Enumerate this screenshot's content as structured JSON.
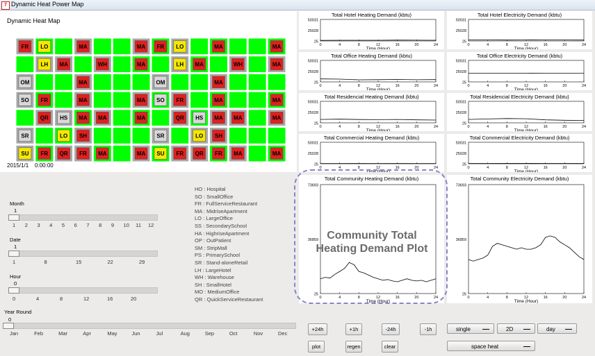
{
  "window": {
    "title": "Dynamic Heat Power Map"
  },
  "map": {
    "title": "Dynamic Heat Map",
    "date": "2015/1/1",
    "time": "0:00:00",
    "rows": [
      [
        "FR",
        "LO",
        "",
        "MA",
        "",
        "",
        "MA",
        "FR",
        "LO",
        "",
        "MA",
        "",
        "",
        "MA"
      ],
      [
        "",
        "LH",
        "MA",
        "",
        "WH",
        "",
        "MA",
        "",
        "LH",
        "MA",
        "",
        "WH",
        "",
        "MA"
      ],
      [
        "OM",
        "",
        "",
        "MA",
        "",
        "",
        "",
        "OM",
        "",
        "",
        "MA",
        "",
        "",
        ""
      ],
      [
        "SO",
        "FR",
        "",
        "MA",
        "",
        "",
        "MA",
        "SO",
        "FR",
        "",
        "MA",
        "",
        "",
        "MA"
      ],
      [
        "",
        "QR",
        "HS",
        "MA",
        "MA",
        "",
        "MA",
        "",
        "QR",
        "HS",
        "MA",
        "MA",
        "",
        "MA"
      ],
      [
        "SR",
        "",
        "LO",
        "SH",
        "",
        "",
        "",
        "SR",
        "",
        "LO",
        "SH",
        "",
        "",
        ""
      ],
      [
        "SU",
        "FR",
        "QR",
        "FR",
        "MA",
        "",
        "MA",
        "SU",
        "FR",
        "QR",
        "FR",
        "MA",
        "",
        "MA"
      ]
    ]
  },
  "charts": [
    {
      "id": "hotel-heating",
      "title": "Total Hotel Heating Demand (kbtu)",
      "yticks": [
        "50031",
        "25028",
        "25"
      ],
      "xticks": [
        "0",
        "4",
        "8",
        "12",
        "16",
        "20",
        "24"
      ],
      "xlabel": "Time (Hour)"
    },
    {
      "id": "hotel-electricity",
      "title": "Total Hotel Electricity Demand (kbtu)",
      "yticks": [
        "50031",
        "25028",
        "25"
      ],
      "xticks": [
        "0",
        "4",
        "8",
        "12",
        "16",
        "20",
        "24"
      ],
      "xlabel": "Time (Hour)"
    },
    {
      "id": "office-heating",
      "title": "Total Office Heating Demand (kbtu)",
      "yticks": [
        "50031",
        "25028",
        "25"
      ],
      "xticks": [
        "0",
        "4",
        "8",
        "12",
        "16",
        "20",
        "24"
      ],
      "xlabel": "Time (Hour)"
    },
    {
      "id": "office-electricity",
      "title": "Total Office Electricity Demand (kbtu)",
      "yticks": [
        "50031",
        "25028",
        "25"
      ],
      "xticks": [
        "0",
        "4",
        "8",
        "12",
        "16",
        "20",
        "24"
      ],
      "xlabel": "Time (Hour)"
    },
    {
      "id": "residential-heating",
      "title": "Total Residencial Heating Demand (kbtu)",
      "yticks": [
        "50031",
        "25028",
        "25"
      ],
      "xticks": [
        "0",
        "4",
        "8",
        "12",
        "16",
        "20",
        "24"
      ],
      "xlabel": "Time (Hour)"
    },
    {
      "id": "residential-electricity",
      "title": "Total Residencial Electricity Demand (kbtu)",
      "yticks": [
        "50031",
        "25028",
        "25"
      ],
      "xticks": [
        "0",
        "4",
        "8",
        "12",
        "16",
        "20",
        "24"
      ],
      "xlabel": "Time (Hour)"
    },
    {
      "id": "commercial-heating",
      "title": "Total Commercial Heating Demand (kbtu)",
      "yticks": [
        "50031",
        "25028",
        "25"
      ],
      "xticks": [
        "0",
        "4",
        "8",
        "12",
        "16",
        "20",
        "24"
      ],
      "xlabel": "Time (Hour)"
    },
    {
      "id": "commercial-electricity",
      "title": "Total Commercial Electricity Demand (kbtu)",
      "yticks": [
        "50031",
        "25028",
        "25"
      ],
      "xticks": [
        "0",
        "4",
        "8",
        "12",
        "16",
        "20",
        "24"
      ],
      "xlabel": "Time (Hour)"
    },
    {
      "id": "community-heating",
      "title": "Total Community Heating Demand (kbtu)",
      "yticks": [
        "73693",
        "36859",
        "25"
      ],
      "xticks": [
        "0",
        "4",
        "8",
        "12",
        "16",
        "20",
        "24"
      ],
      "xlabel": "Time (Hour)"
    },
    {
      "id": "community-electricity",
      "title": "Total Community Electricity Demand (kbtu)",
      "yticks": [
        "73693",
        "36859",
        "25"
      ],
      "xticks": [
        "0",
        "4",
        "8",
        "12",
        "16",
        "20",
        "24"
      ],
      "xlabel": "Time (Hour)"
    }
  ],
  "chart_data": [
    {
      "type": "line",
      "title": "Total Hotel Heating Demand (kbtu)",
      "xlabel": "Time (Hour)",
      "ylim": [
        25,
        50031
      ],
      "x": [
        0,
        4,
        8,
        12,
        16,
        20,
        24
      ],
      "values": [
        1500,
        1600,
        1700,
        1600,
        2000,
        1800,
        1600
      ]
    },
    {
      "type": "line",
      "title": "Total Hotel Electricity Demand (kbtu)",
      "xlabel": "Time (Hour)",
      "ylim": [
        25,
        50031
      ],
      "x": [
        0,
        4,
        8,
        12,
        16,
        20,
        24
      ],
      "values": [
        2600,
        2400,
        2200,
        2300,
        2500,
        2300,
        2200
      ]
    },
    {
      "type": "line",
      "title": "Total Office Heating Demand (kbtu)",
      "xlabel": "Time (Hour)",
      "ylim": [
        25,
        50031
      ],
      "x": [
        0,
        4,
        8,
        12,
        16,
        20,
        24
      ],
      "values": [
        7000,
        6500,
        4800,
        5200,
        5600,
        5000,
        5400
      ]
    },
    {
      "type": "line",
      "title": "Total Office Electricity Demand (kbtu)",
      "xlabel": "Time (Hour)",
      "ylim": [
        25,
        50031
      ],
      "x": [
        0,
        4,
        8,
        12,
        16,
        20,
        24
      ],
      "values": [
        20000,
        20000,
        20200,
        20300,
        20100,
        20000,
        20000
      ]
    },
    {
      "type": "line",
      "title": "Total Residencial Heating Demand (kbtu)",
      "xlabel": "Time (Hour)",
      "ylim": [
        25,
        50031
      ],
      "x": [
        0,
        4,
        8,
        12,
        16,
        20,
        24
      ],
      "values": [
        8000,
        8600,
        7800,
        7400,
        8000,
        7000,
        6500
      ]
    },
    {
      "type": "line",
      "title": "Total Residencial Electricity Demand (kbtu)",
      "xlabel": "Time (Hour)",
      "ylim": [
        25,
        50031
      ],
      "x": [
        0,
        4,
        8,
        12,
        16,
        20,
        24
      ],
      "values": [
        8000,
        9000,
        10000,
        9500,
        7000,
        6000,
        5500
      ]
    },
    {
      "type": "line",
      "title": "Total Commercial Heating Demand (kbtu)",
      "xlabel": "Time (Hour)",
      "ylim": [
        25,
        50031
      ],
      "x": [
        0,
        4,
        8,
        12,
        16,
        20,
        24
      ],
      "values": [
        600,
        700,
        800,
        700,
        800,
        700,
        700
      ]
    },
    {
      "type": "line",
      "title": "Total Commercial Electricity Demand (kbtu)",
      "xlabel": "Time (Hour)",
      "ylim": [
        25,
        50031
      ],
      "x": [
        0,
        4,
        8,
        12,
        16,
        20,
        24
      ],
      "values": [
        900,
        900,
        950,
        950,
        900,
        900,
        900
      ]
    },
    {
      "type": "line",
      "title": "Total Community Heating Demand (kbtu)",
      "xlabel": "Time (Hour)",
      "ylim": [
        25,
        73693
      ],
      "x": [
        0,
        1,
        2,
        3,
        4,
        5,
        6,
        7,
        8,
        9,
        10,
        11,
        12,
        13,
        14,
        15,
        16,
        17,
        18,
        19,
        20,
        21,
        22,
        23,
        24
      ],
      "values": [
        10000,
        11000,
        10500,
        13000,
        15000,
        17000,
        21000,
        19500,
        15000,
        14000,
        12500,
        11000,
        10000,
        9000,
        9500,
        8500,
        8000,
        9000,
        10000,
        9000,
        8500,
        9000,
        8000,
        9000,
        10000
      ]
    },
    {
      "type": "line",
      "title": "Total Community Electricity Demand (kbtu)",
      "xlabel": "Time (Hour)",
      "ylim": [
        25,
        73693
      ],
      "x": [
        0,
        1,
        2,
        3,
        4,
        5,
        6,
        7,
        8,
        9,
        10,
        11,
        12,
        13,
        14,
        15,
        16,
        17,
        18,
        19,
        20,
        21,
        22,
        23,
        24
      ],
      "values": [
        23000,
        22000,
        23000,
        24000,
        26000,
        32000,
        34000,
        33000,
        32000,
        31000,
        30000,
        31000,
        30000,
        30000,
        31000,
        33000,
        38000,
        39000,
        38000,
        35000,
        33000,
        31000,
        28000,
        25000,
        23000
      ]
    }
  ],
  "overlay": {
    "line1": "Community Total",
    "line2": "Heating Demand Plot"
  },
  "legend": [
    "HO : Hospital",
    "SO : SmallOffice",
    "FR : FullServiceRestaurant",
    "MA : MidriseApartment",
    "LO : LargeOffice",
    "SS : SecondarySchool",
    "HA : HighriseApartment",
    "OP : OutPatient",
    "SM : StripMall",
    "PS : PrimarySchool",
    "SR : Stand-aloneRetail",
    "LH : LargeHotel",
    "WH : Warehouse",
    "SH : SmallHotel",
    "MO : MediumOffice",
    "QR : QuickServiceRestaurant"
  ],
  "sliders": {
    "month": {
      "label": "Month",
      "value": "1",
      "ticks": [
        "1",
        "2",
        "3",
        "4",
        "5",
        "6",
        "7",
        "8",
        "9",
        "10",
        "11",
        "12"
      ]
    },
    "date": {
      "label": "Date",
      "value": "1",
      "ticks": [
        "1",
        "8",
        "15",
        "22",
        "29"
      ]
    },
    "hour": {
      "label": "Hour",
      "value": "0",
      "ticks": [
        "0",
        "4",
        "8",
        "12",
        "16",
        "20"
      ]
    },
    "year": {
      "label": "Year Round",
      "value": "0",
      "ticks": [
        "Jan",
        "Feb",
        "Mar",
        "Apr",
        "May",
        "Jun",
        "Jul",
        "Aug",
        "Sep",
        "Oct",
        "Nov",
        "Dec"
      ]
    }
  },
  "buttons": {
    "plus24": "+24h",
    "plus1": "+1h",
    "minus24": "-24h",
    "minus1": "-1h",
    "plot": "plot",
    "regen": "regen",
    "clear": "clear"
  },
  "dropdowns": {
    "mode": "single",
    "dim": "2D",
    "range": "day",
    "energy": "space heat"
  },
  "colors": {
    "green": "#00ff00",
    "block": "#a8a8a8",
    "tileRed": "#e02020",
    "tileYellow": "#f5e800",
    "overlay": "#8585cc"
  }
}
